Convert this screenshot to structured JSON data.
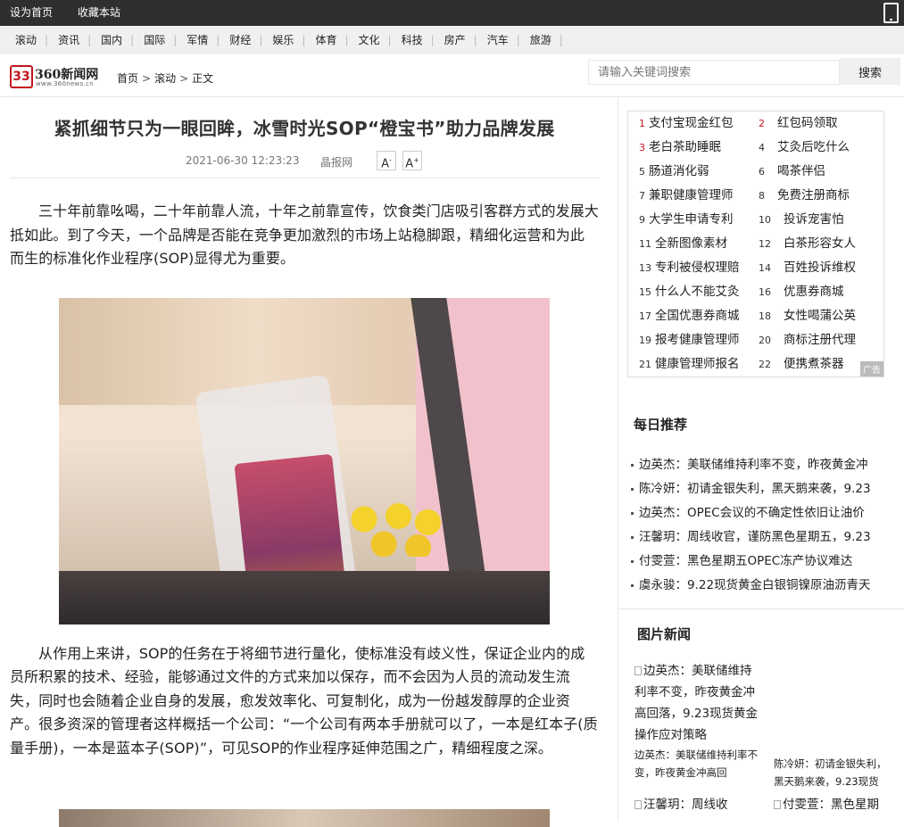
{
  "topbar": {
    "set_home": "设为首页",
    "bookmark": "收藏本站"
  },
  "nav": [
    "滚动",
    "资讯",
    "国内",
    "国际",
    "军情",
    "财经",
    "娱乐",
    "体育",
    "文化",
    "科技",
    "房产",
    "汽车",
    "旅游"
  ],
  "logo": {
    "mark": "33",
    "brand": "360新闻网",
    "sub": "www.360news.cn"
  },
  "breadcrumb": [
    "首页",
    "滚动",
    "正文"
  ],
  "search": {
    "placeholder": "请输入关键词搜索",
    "button": "搜索"
  },
  "article": {
    "title": "紧抓细节只为一眼回眸，冰雪时光SOP“橙宝书”助力品牌发展",
    "date": "2021-06-30 12:23:23",
    "source": "晶报网",
    "font_down": "A",
    "font_up": "A",
    "p1": "三十年前靠吆喝，二十年前靠人流，十年之前靠宣传，饮食类门店吸引客群方式的发展大抵如此。到了今天，一个品牌是否能在竞争更加激烈的市场上站稳脚跟，精细化运营和为此而生的标准化作业程序(SOP)显得尤为重要。",
    "p2": "从作用上来讲，SOP的任务在于将细节进行量化，使标准没有歧义性，保证企业内的成员所积累的技术、经验，能够通过文件的方式来加以保存，而不会因为人员的流动发生流失，同时也会随着企业自身的发展，愈发效率化、可复制化，成为一份越发醇厚的企业资产。很多资深的管理者这样概括一个公司：“一个公司有两本手册就可以了，一本是红本子(质量手册)，一本是蓝本子(SOP)”，可见SOP的作业程序延伸范围之广，精细程度之深。"
  },
  "hot": [
    {
      "n": "1",
      "t": "支付宝现金红包"
    },
    {
      "n": "2",
      "t": "红包码领取"
    },
    {
      "n": "3",
      "t": "老白茶助睡眠"
    },
    {
      "n": "4",
      "t": "艾灸后吃什么"
    },
    {
      "n": "5",
      "t": "肠道消化弱"
    },
    {
      "n": "6",
      "t": "喝茶伴侣"
    },
    {
      "n": "7",
      "t": "兼职健康管理师"
    },
    {
      "n": "8",
      "t": "免费注册商标"
    },
    {
      "n": "9",
      "t": "大学生申请专利"
    },
    {
      "n": "10",
      "t": "投诉宠害怕"
    },
    {
      "n": "11",
      "t": "全新图像素材"
    },
    {
      "n": "12",
      "t": "白茶形容女人"
    },
    {
      "n": "13",
      "t": "专利被侵权理赔"
    },
    {
      "n": "14",
      "t": "百姓投诉维权"
    },
    {
      "n": "15",
      "t": "什么人不能艾灸"
    },
    {
      "n": "16",
      "t": "优惠券商城"
    },
    {
      "n": "17",
      "t": "全国优惠券商城"
    },
    {
      "n": "18",
      "t": "女性喝蒲公英"
    },
    {
      "n": "19",
      "t": "报考健康管理师"
    },
    {
      "n": "20",
      "t": "商标注册代理"
    },
    {
      "n": "21",
      "t": "健康管理师报名"
    },
    {
      "n": "22",
      "t": "便携煮茶器"
    }
  ],
  "ad_tag": "广告",
  "daily": {
    "title": "每日推荐",
    "items": [
      "边英杰：美联储维持利率不变，昨夜黄金冲",
      "陈冷妍：初请金银失利，黑天鹅来袭，9.23",
      "边英杰：OPEC会议的不确定性依旧让油价",
      "汪馨玥：周线收官，谨防黑色星期五，9.23",
      "付雯萱：黑色星期五OPEC冻产协议难达",
      "虞永骏：9.22现货黄金白银铜镍原油沥青天"
    ]
  },
  "pics": {
    "title": "图片新闻",
    "alt1": "边英杰：美联储维持利率不变，昨夜黄金冲高回落，9.23现货黄金操作应对策略",
    "cap1": "边英杰：美联储维持利率不变，昨夜黄金冲高回",
    "cap2": "陈冷妍：初请金银失利，黑天鹅来袭，9.23现货",
    "alt3": "汪馨玥：周线收",
    "alt4": "付雯萱：黑色星期"
  }
}
